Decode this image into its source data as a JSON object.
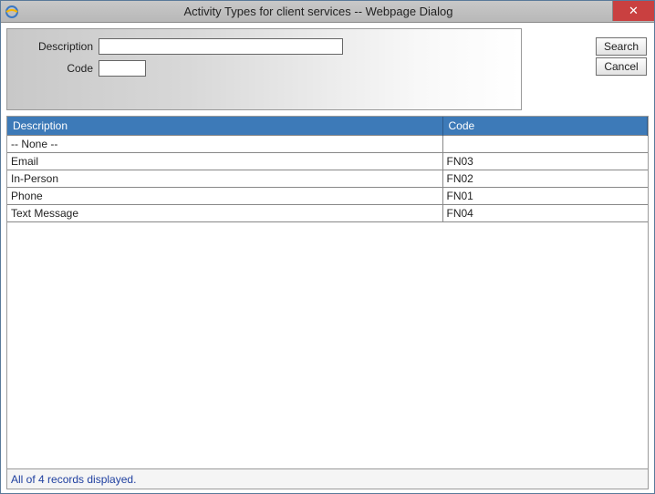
{
  "window": {
    "title": "Activity Types for client services -- Webpage Dialog"
  },
  "search": {
    "description_label": "Description",
    "description_value": "",
    "description_placeholder": "",
    "code_label": "Code",
    "code_value": "",
    "code_placeholder": ""
  },
  "buttons": {
    "search": "Search",
    "cancel": "Cancel",
    "close_symbol": "✕"
  },
  "table": {
    "columns": {
      "description": "Description",
      "code": "Code"
    },
    "rows": [
      {
        "description": "-- None --",
        "code": ""
      },
      {
        "description": "Email",
        "code": "FN03"
      },
      {
        "description": "In-Person",
        "code": "FN02"
      },
      {
        "description": "Phone",
        "code": "FN01"
      },
      {
        "description": "Text Message",
        "code": "FN04"
      }
    ]
  },
  "status": "All of 4 records displayed.",
  "colors": {
    "header_bg": "#3d7ab8",
    "close_bg": "#c94040"
  }
}
